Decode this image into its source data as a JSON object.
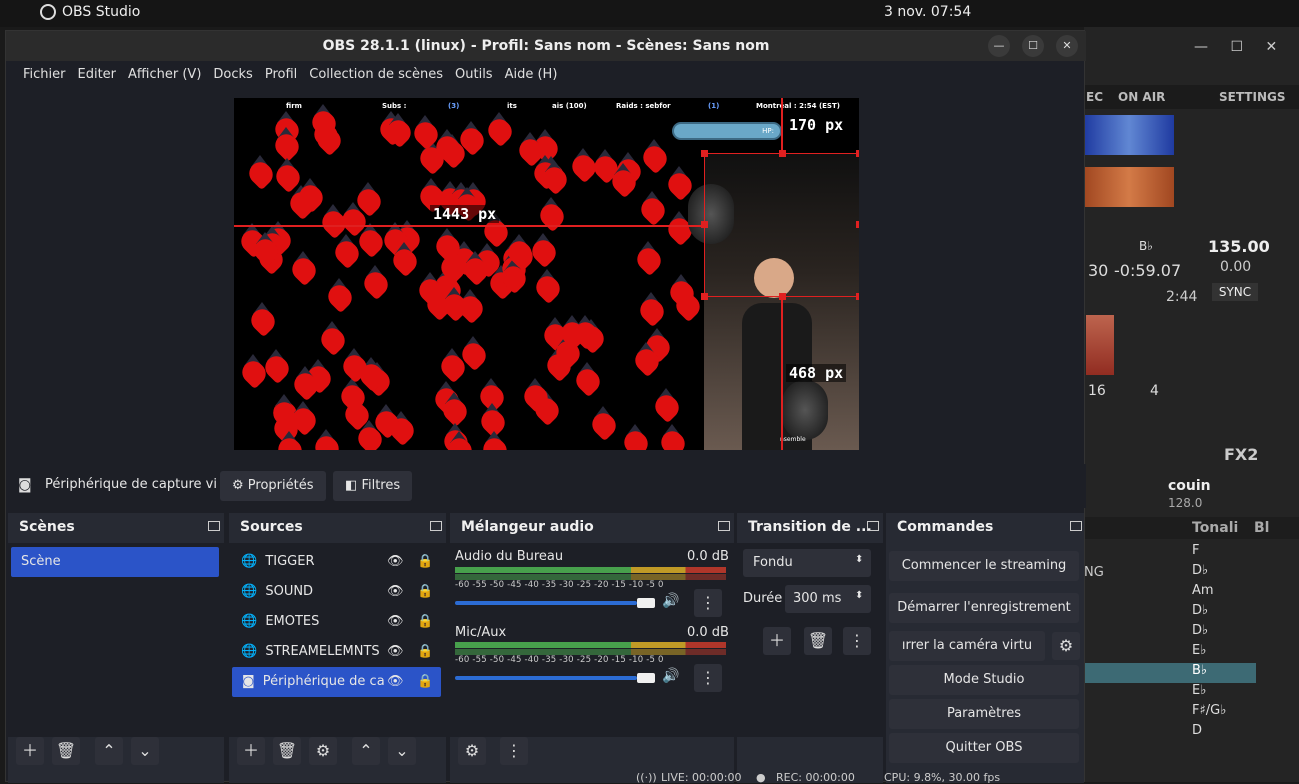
{
  "system": {
    "app_name": "OBS Studio",
    "clock": "3 nov.  07:54"
  },
  "window": {
    "title": "OBS 28.1.1 (linux) - Profil: Sans nom - Scènes: Sans nom"
  },
  "menu": [
    "Fichier",
    "Editer",
    "Afficher (V)",
    "Docks",
    "Profil",
    "Collection de scènes",
    "Outils",
    "Aide (H)"
  ],
  "preview": {
    "overlay_texts": [
      "firm",
      "Subs :",
      "(3)",
      "its",
      "ais (100)",
      "Raids : sebfor",
      "(1)",
      "Montréal : 2:54 (EST)",
      "HP:",
      "nsemble"
    ],
    "label_width": "1443  px",
    "label_top": "170  px",
    "label_bottom": "468  px"
  },
  "source_toolbar": {
    "source_name": "Périphérique de capture vi",
    "properties": "Propriétés",
    "filters": "Filtres"
  },
  "scenes": {
    "title": "Scènes",
    "items": [
      "Scène"
    ]
  },
  "sources": {
    "title": "Sources",
    "items": [
      "TIGGER",
      "SOUND",
      "EMOTES",
      "STREAMELEMNTS",
      "Périphérique de ca"
    ]
  },
  "mixer": {
    "title": "Mélangeur audio",
    "scale": "-60 -55 -50 -45 -40 -35 -30 -25 -20 -15 -10  -5   0",
    "channels": [
      {
        "name": "Audio du Bureau",
        "db": "0.0 dB",
        "volume": 1.0
      },
      {
        "name": "Mic/Aux",
        "db": "0.0 dB",
        "volume": 1.0
      }
    ]
  },
  "transition": {
    "title": "Transition de ...",
    "type": "Fondu",
    "duration_label": "Durée",
    "duration": "300 ms"
  },
  "commands": {
    "title": "Commandes",
    "buttons": [
      "Commencer le streaming",
      "Démarrer l'enregistrement",
      "ırrer la caméra virtu",
      "Mode Studio",
      "Paramètres",
      "Quitter OBS"
    ]
  },
  "status": {
    "live": "LIVE: 00:00:00",
    "rec": "REC: 00:00:00",
    "cpu": "CPU: 9.8%, 30.00 fps"
  },
  "bgapp": {
    "tabs": [
      "EC",
      "ON AIR",
      "SETTINGS"
    ],
    "bpm": "135.00",
    "rate": "0.00",
    "key": "B♭",
    "time_left": "-0:59.07",
    "time_a": "30",
    "duration": "2:44",
    "sync": "SYNC",
    "loop_a": "16",
    "loop_b": "4",
    "fx": "FX2",
    "track_title": "couin",
    "track_bpm": "128.0",
    "col_tonality": "Tonali",
    "col_bl": "Bl",
    "keys": [
      "F",
      "D♭",
      "Am",
      "D♭",
      "D♭",
      "E♭",
      "B♭",
      "E♭",
      "F♯/G♭",
      "D"
    ],
    "side_text": [
      "NG"
    ]
  },
  "colors": {
    "accent": "#2b54c8",
    "selection_red": "#e02020"
  }
}
